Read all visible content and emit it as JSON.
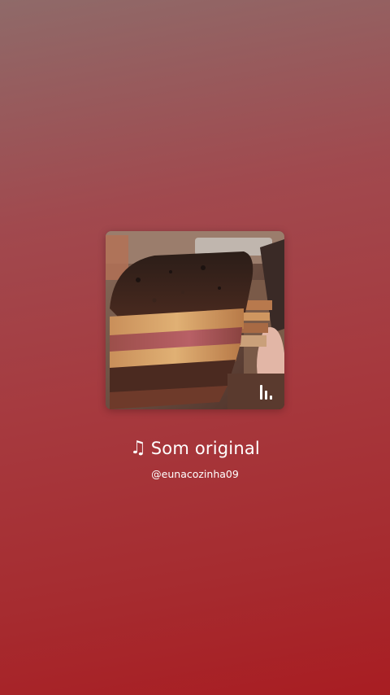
{
  "audio": {
    "title": "Som original",
    "author": "@eunacozinha09",
    "note_icon": "♫",
    "cover_description_icon": "equalizer-bars-icon"
  },
  "colors": {
    "background_top": "#8f6a69",
    "background_bottom": "#a81d22",
    "text": "#ffffff"
  }
}
